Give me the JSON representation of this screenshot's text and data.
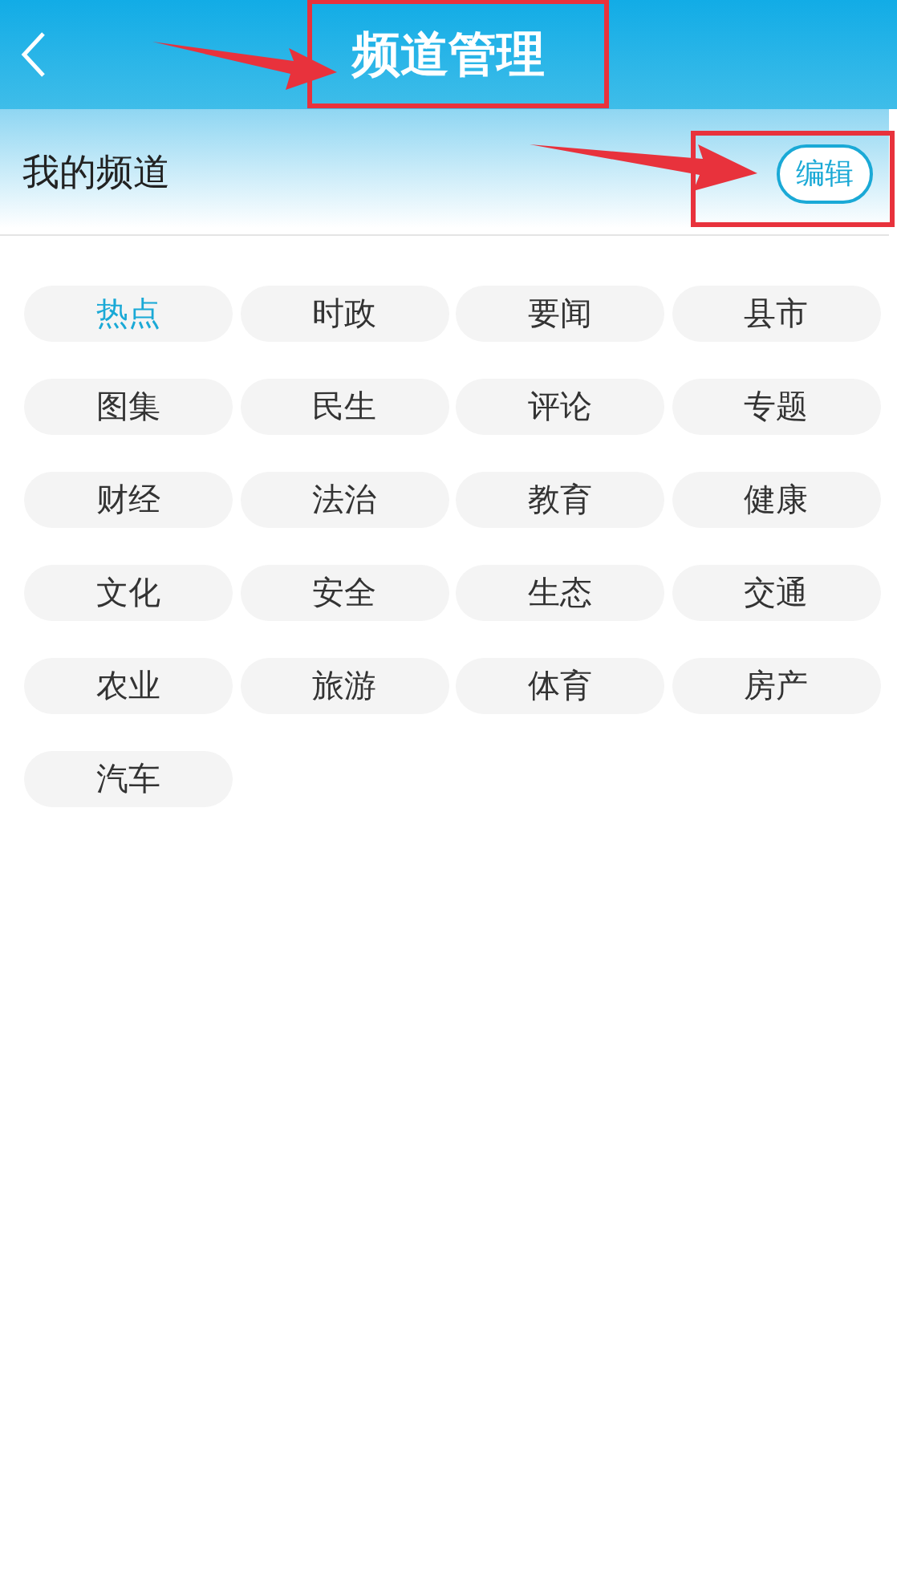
{
  "window": {
    "title": "频道管理"
  },
  "section": {
    "title": "我的频道",
    "edit_button": "编辑"
  },
  "channels": [
    {
      "label": "热点",
      "selected": true
    },
    {
      "label": "时政",
      "selected": false
    },
    {
      "label": "要闻",
      "selected": false
    },
    {
      "label": "县市",
      "selected": false
    },
    {
      "label": "图集",
      "selected": false
    },
    {
      "label": "民生",
      "selected": false
    },
    {
      "label": "评论",
      "selected": false
    },
    {
      "label": "专题",
      "selected": false
    },
    {
      "label": "财经",
      "selected": false
    },
    {
      "label": "法治",
      "selected": false
    },
    {
      "label": "教育",
      "selected": false
    },
    {
      "label": "健康",
      "selected": false
    },
    {
      "label": "文化",
      "selected": false
    },
    {
      "label": "安全",
      "selected": false
    },
    {
      "label": "生态",
      "selected": false
    },
    {
      "label": "交通",
      "selected": false
    },
    {
      "label": "农业",
      "selected": false
    },
    {
      "label": "旅游",
      "selected": false
    },
    {
      "label": "体育",
      "selected": false
    },
    {
      "label": "房产",
      "selected": false
    },
    {
      "label": "汽车",
      "selected": false
    }
  ]
}
